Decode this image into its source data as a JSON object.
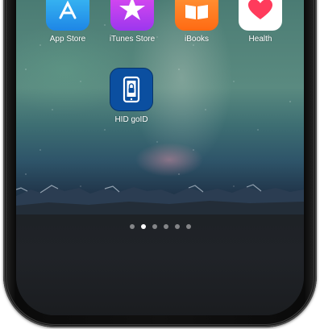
{
  "home_screen": {
    "top_row": [
      {
        "name": "app-store",
        "label": "App Store"
      },
      {
        "name": "itunes-store",
        "label": "iTunes Store"
      },
      {
        "name": "ibooks",
        "label": "iBooks"
      },
      {
        "name": "health",
        "label": "Health"
      }
    ],
    "featured_app": {
      "label": "HID goID"
    },
    "page_indicator": {
      "total_pages": 6,
      "current_page": 2
    }
  },
  "colors": {
    "hid_icon_blue": "#0b4fa0",
    "health_heart": "#ff3b5c",
    "app_store_blue": "#1e86e6",
    "itunes_purple": "#9c37ee",
    "ibooks_orange": "#ff6a13"
  },
  "icons": {
    "app_store": "app-store-a-icon",
    "itunes_store": "star-icon",
    "ibooks": "open-book-icon",
    "health": "heart-icon",
    "hid_goid": "phone-lock-icon"
  }
}
